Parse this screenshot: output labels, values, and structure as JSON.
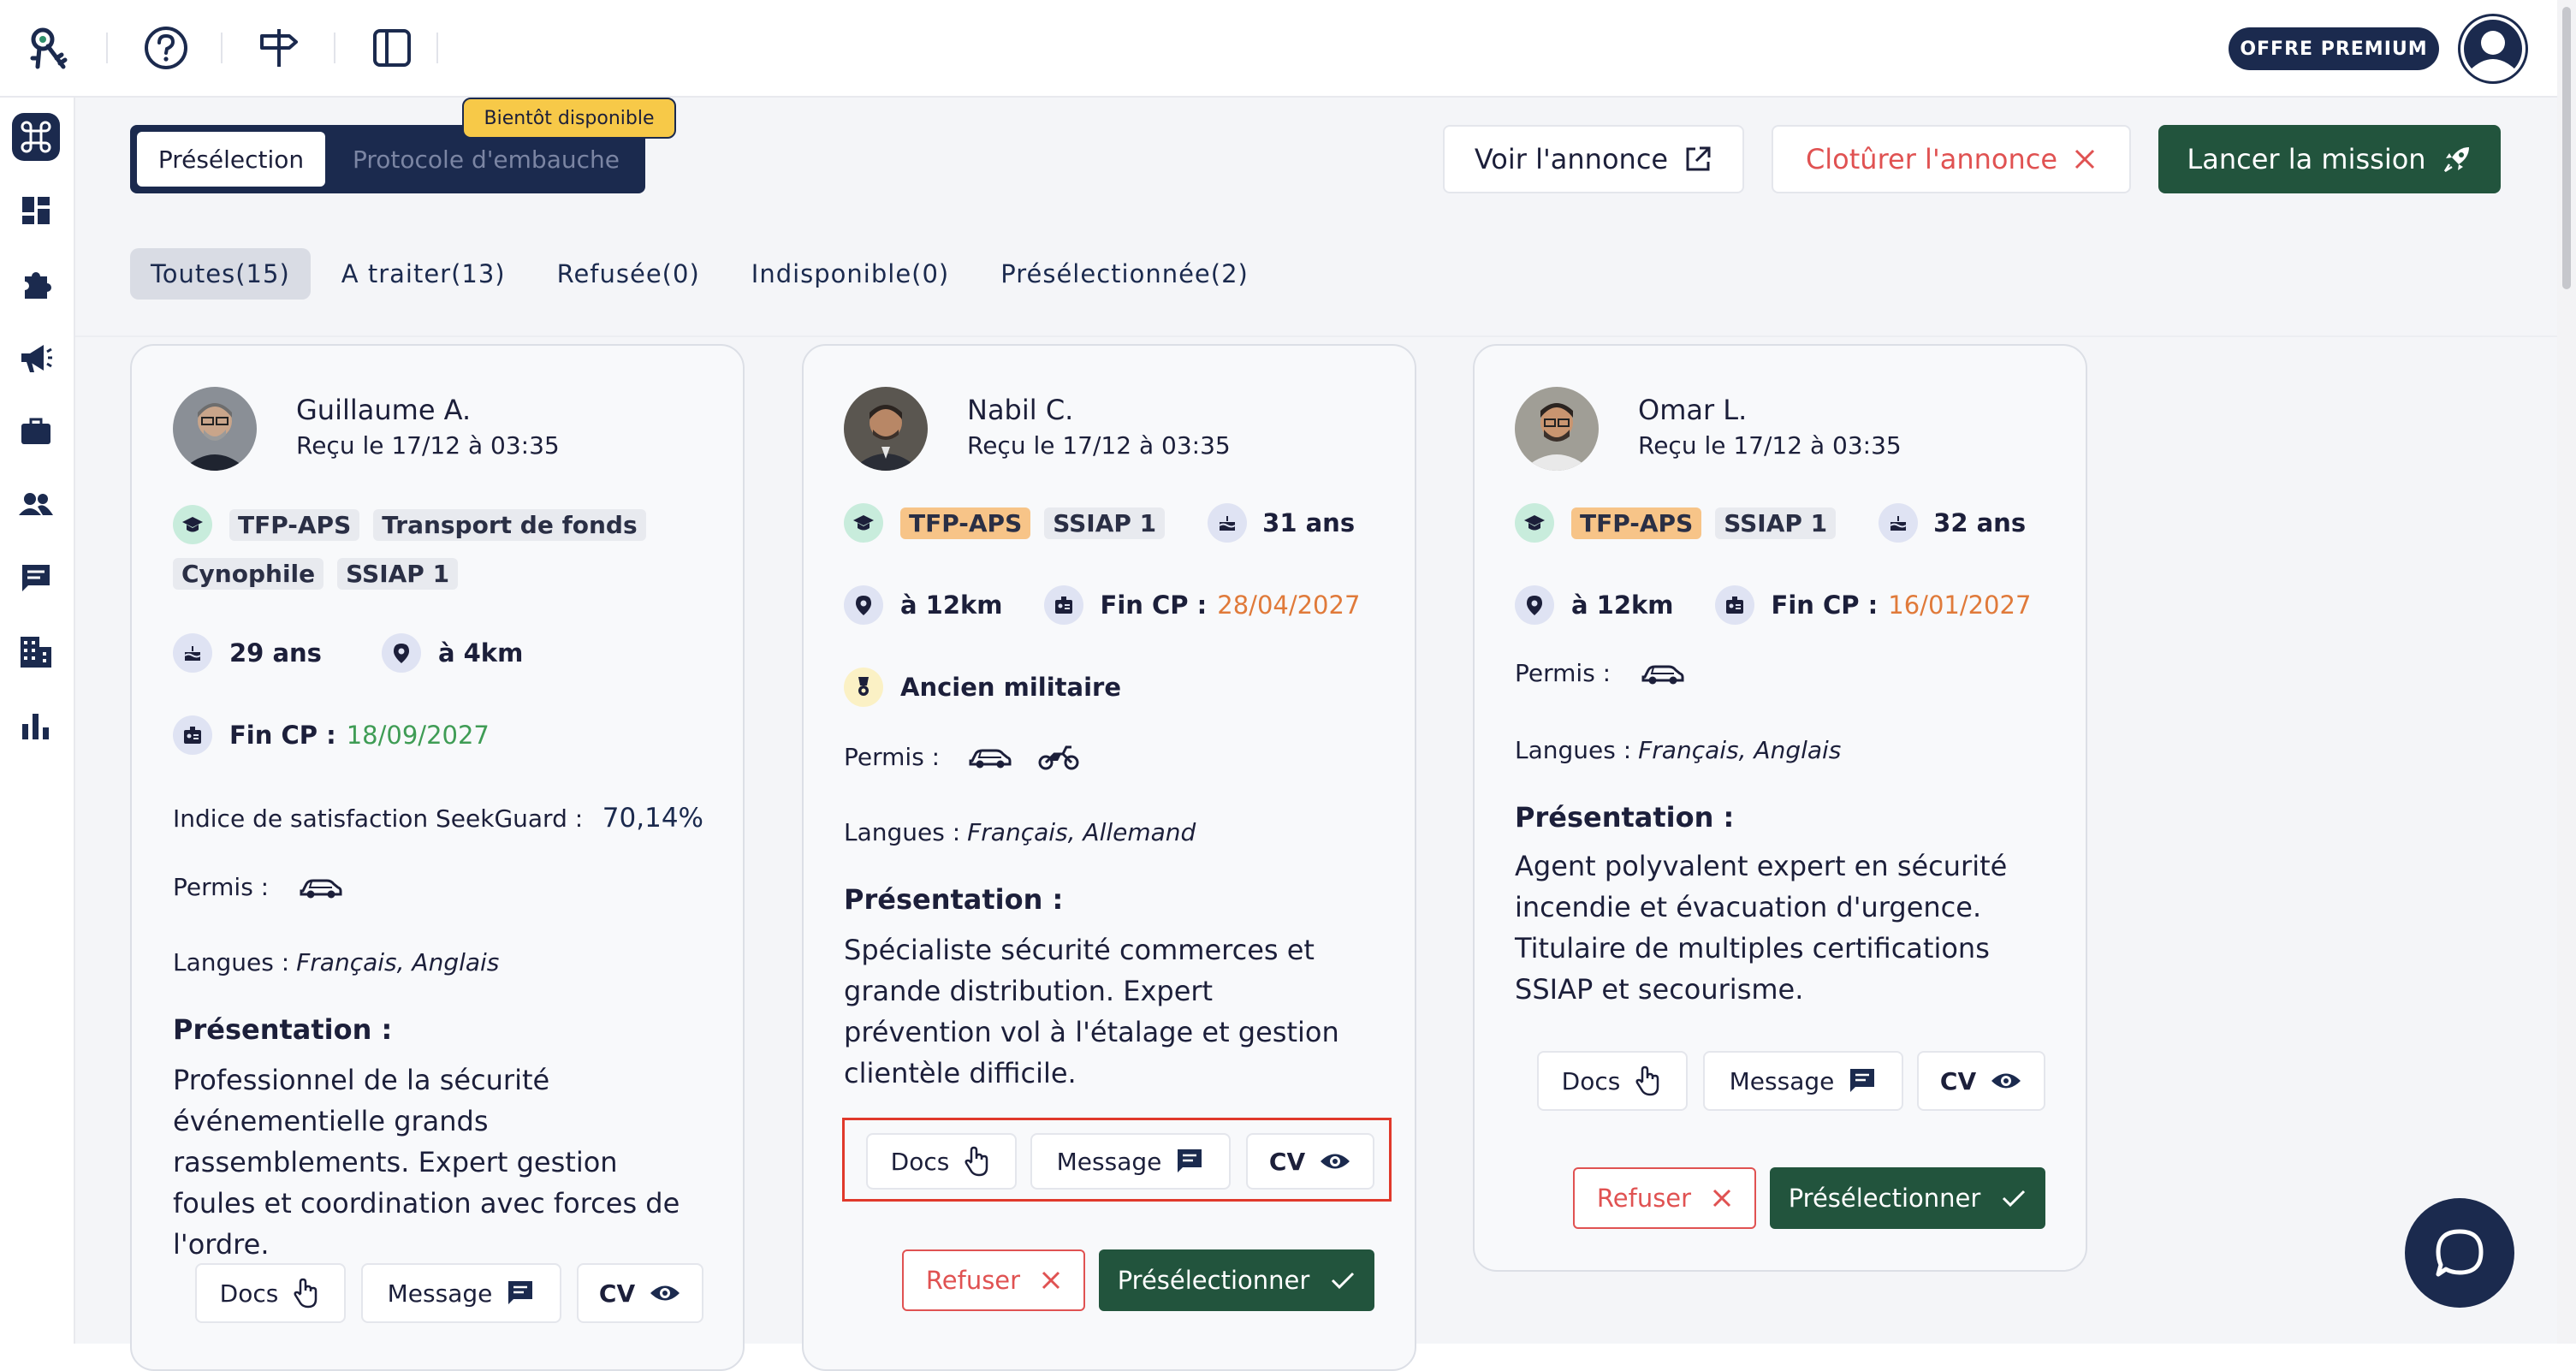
{
  "topbar": {
    "premium_label": "OFFRE PREMIUM"
  },
  "icons": {
    "logo": "keys-icon",
    "help": "help-circle-icon",
    "signpost": "signpost-icon",
    "panel": "sidebar-panel-icon",
    "user": "user-avatar-icon"
  },
  "sidebar": {
    "items": [
      "command-icon",
      "dashboard-icon",
      "puzzle-icon",
      "megaphone-icon",
      "briefcase-icon",
      "people-icon",
      "chat-icon",
      "building-icon",
      "bar-chart-icon"
    ]
  },
  "header": {
    "segments": {
      "active": "Présélection",
      "inactive": "Protocole d'embauche"
    },
    "soon_badge": "Bientôt disponible",
    "voir": "Voir l'annonce",
    "cloturer": "Clotûrer l'annonce",
    "lancer": "Lancer la mission"
  },
  "filters": [
    "Toutes(15)",
    "A traiter(13)",
    "Refusée(0)",
    "Indisponible(0)",
    "Présélectionnée(2)"
  ],
  "common": {
    "docs": "Docs",
    "message": "Message",
    "cv": "CV",
    "refuser": "Refuser",
    "preselectionner": "Présélectionner",
    "permis": "Permis :",
    "langues_label": "Langues :",
    "presentation_title": "Présentation :",
    "fin_cp": "Fin CP :",
    "satisfaction_label": "Indice de satisfaction SeekGuard :"
  },
  "candidates": [
    {
      "name": "Guillaume A.",
      "received": "Reçu le 17/12 à 03:35",
      "tags": [
        "TFP-APS",
        "Transport de fonds",
        "Cynophile",
        "SSIAP 1"
      ],
      "age": "29 ans",
      "distance": "à 4km",
      "fin_cp": "18/09/2027",
      "satisfaction": "70,14%",
      "languages": "Français, Anglais",
      "presentation": "Professionnel de la sécurité événementielle grands rassemblements. Expert gestion foules et coordination avec forces de l'ordre."
    },
    {
      "name": "Nabil C.",
      "received": "Reçu le 17/12 à 03:35",
      "tags": [
        "TFP-APS",
        "SSIAP 1"
      ],
      "age": "31 ans",
      "distance": "à 12km",
      "fin_cp": "28/04/2027",
      "extra": "Ancien militaire",
      "languages": "Français, Allemand",
      "presentation": "Spécialiste sécurité commerces et grande distribution. Expert prévention vol à l'étalage et gestion clientèle difficile."
    },
    {
      "name": "Omar L.",
      "received": "Reçu le 17/12 à 03:35",
      "tags": [
        "TFP-APS",
        "SSIAP 1"
      ],
      "age": "32 ans",
      "distance": "à 12km",
      "fin_cp": "16/01/2027",
      "languages": "Français, Anglais",
      "presentation": "Agent polyvalent expert en sécurité incendie et évacuation d'urgence. Titulaire de multiples certifications SSIAP et secourisme."
    }
  ],
  "colors": {
    "navy": "#1b2a4e",
    "green": "#22543d",
    "red": "#e05252",
    "orange": "#e07a3a",
    "date_green": "#3f9c55"
  }
}
